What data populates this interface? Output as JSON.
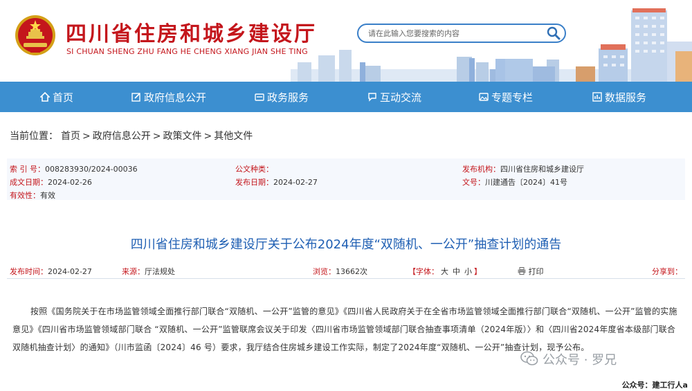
{
  "header": {
    "site_title": "四川省住房和城乡建设厅",
    "site_subtitle": "SI CHUAN SHENG ZHU FANG HE CHENG XIANG JIAN SHE TING",
    "search_placeholder": "请在此输入您要搜索的内容",
    "search_icon": "search-icon",
    "emblem_icon": "national-emblem-icon"
  },
  "nav": {
    "items": [
      {
        "label": "首页",
        "icon": "home-icon"
      },
      {
        "label": "政府信息公开",
        "icon": "edit-icon"
      },
      {
        "label": "政务服务",
        "icon": "card-icon"
      },
      {
        "label": "互动交流",
        "icon": "chat-icon"
      },
      {
        "label": "专题专栏",
        "icon": "image-icon"
      },
      {
        "label": "数据服务",
        "icon": "chart-icon"
      }
    ]
  },
  "breadcrumb": {
    "label": "当前位置：",
    "items": [
      "首页",
      "政府信息公开",
      "政策文件",
      "其他文件"
    ],
    "separator": ">"
  },
  "meta": {
    "index_key": "索 引 号：",
    "index_val": "008283930/2024-00036",
    "category_key": "公文种类：",
    "category_val": "",
    "org_key": "发布机构：",
    "org_val": "四川省住房和城乡建设厅",
    "created_key": "成文日期：",
    "created_val": "2024-02-26",
    "published_key": "发布日期：",
    "published_val": "2024-02-27",
    "docno_key": "文号：",
    "docno_val": "川建通告〔2024〕41号",
    "validity_key": "有效性：",
    "validity_val": "有效"
  },
  "article": {
    "title": "四川省住房和城乡建设厅关于公布2024年度“双随机、一公开”抽查计划的通告",
    "pubtime_key": "发布时间：",
    "pubtime_val": "2024-02-27",
    "source_key": "来源：",
    "source_val": "厅法规处",
    "views_key": "浏览：",
    "views_val": "13662次",
    "font_label": "【字体：",
    "font_large": "大",
    "font_medium": "中",
    "font_small": "小",
    "font_close": "】",
    "print_label": "打印",
    "share_label": "分享到：",
    "body": "按照《国务院关于在市场监管领域全面推行部门联合“双随机、一公开”监管的意见》《四川省人民政府关于在全省市场监管领域全面推行部门联合“双随机、一公开”监管的实施意见》《四川省市场监管领域部门联合 “双随机、一公开”监管联席会议关于印发〈四川省市场监管领域部门联合抽查事项清单（2024年版）〉和〈四川省2024年度省本级部门联合双随机抽查计划〉的通知》（川市监函〔2024〕46 号）要求，我厅结合住房城乡建设工作实际，制定了2024年度“双随机、一公开”抽查计划，现予公布。"
  },
  "watermark": {
    "text": "公众号 · 罗兄",
    "account": "公众号：建工行人a"
  },
  "colors": {
    "brand_red": "#c4161c",
    "nav_blue": "#3c8fd0",
    "title_blue": "#1f5fb3",
    "meta_bg": "#f5f8fd"
  }
}
